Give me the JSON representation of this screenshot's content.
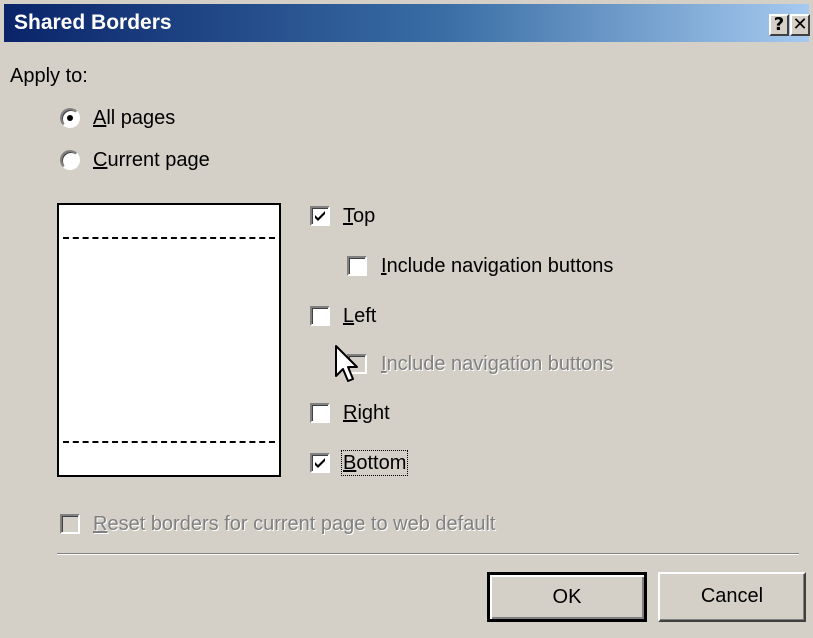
{
  "window": {
    "title": "Shared Borders",
    "help_glyph": "?",
    "close_glyph": "✕"
  },
  "apply_to": {
    "label": "Apply to:",
    "options": [
      {
        "accel": "A",
        "rest": "ll pages",
        "selected": true
      },
      {
        "accel": "C",
        "rest": "urrent page",
        "selected": false
      }
    ]
  },
  "borders": {
    "top": {
      "accel": "T",
      "rest": "op",
      "checked": true
    },
    "top_nav": {
      "accel": "I",
      "rest": "nclude navigation buttons",
      "checked": false,
      "enabled": true
    },
    "left": {
      "accel": "L",
      "rest": "eft",
      "checked": false
    },
    "left_nav": {
      "accel": "I",
      "rest": "nclude navigation buttons",
      "checked": false,
      "enabled": false
    },
    "right": {
      "accel": "R",
      "rest": "ight",
      "checked": false
    },
    "bottom": {
      "accel": "B",
      "rest": "ottom",
      "checked": true,
      "focused": true
    }
  },
  "reset": {
    "accel": "R",
    "rest": "eset borders for current page to web default",
    "checked": false,
    "enabled": false
  },
  "buttons": {
    "ok": "OK",
    "cancel": "Cancel"
  },
  "icons": {
    "check": "checkmark-icon",
    "cursor": "mouse-pointer-icon"
  },
  "colors": {
    "face": "#d4d0c8",
    "title_start": "#0a246a",
    "title_end": "#a6caf0",
    "disabled_text": "#808080"
  }
}
